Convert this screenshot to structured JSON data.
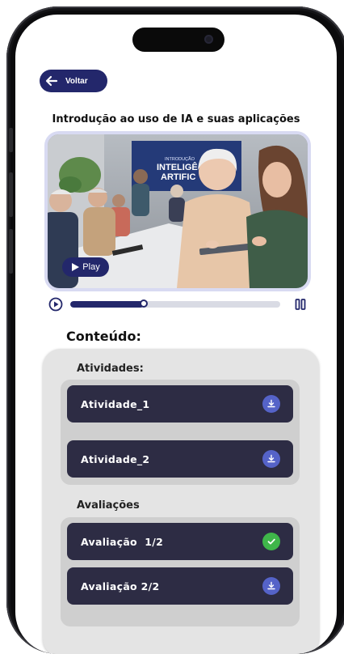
{
  "header": {
    "back_label": "Voltar"
  },
  "lesson": {
    "title": "Introdução ao uso de IA e suas aplicações",
    "video_screen_text_1": "INTRODUÇÃO",
    "video_screen_text_2": "INTELIGÊ",
    "video_screen_text_3": "ARTIFIC",
    "play_label": "Play",
    "progress": 0.35
  },
  "content": {
    "title": "Conteúdo:",
    "activities_label": "Atividades:",
    "activities": [
      {
        "label": "Atividade_1",
        "icon": "download-icon"
      },
      {
        "label": "Atividade_2",
        "icon": "download-icon"
      }
    ],
    "evaluations_label": "Avaliações",
    "evaluations": [
      {
        "label": "Avaliação  1/2",
        "icon": "check-icon"
      },
      {
        "label": "Avaliação 2/2",
        "icon": "download-icon"
      }
    ]
  },
  "colors": {
    "primary": "#23276b",
    "item_bg": "#2d2c44",
    "download_badge": "#5563c8",
    "check_badge": "#3fb64a"
  }
}
